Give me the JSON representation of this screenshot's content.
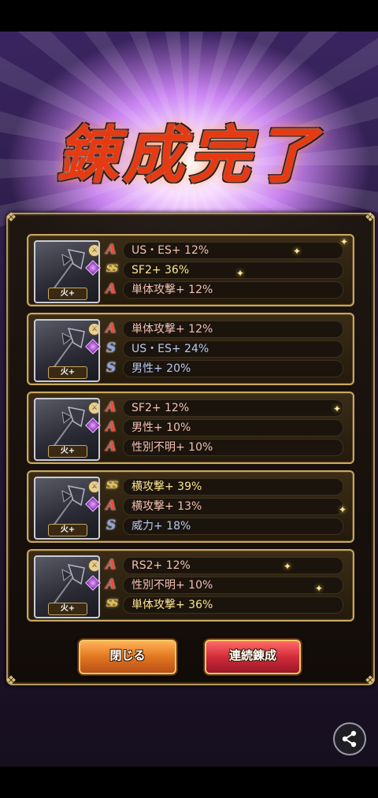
{
  "title": "錬成完了",
  "cards": [
    {
      "weapon_label": "火+",
      "rows": [
        {
          "rank": "A",
          "text": "US・ES+ 12%",
          "color": "#f2c0b4"
        },
        {
          "rank": "SS",
          "text": "SF2+ 36%",
          "color": "#ffe590"
        },
        {
          "rank": "A",
          "text": "単体攻撃+ 12%",
          "color": "#f2c0b4"
        }
      ]
    },
    {
      "weapon_label": "火+",
      "rows": [
        {
          "rank": "A",
          "text": "単体攻撃+ 12%",
          "color": "#f2c0b4"
        },
        {
          "rank": "S",
          "text": "US・ES+ 24%",
          "color": "#b8c8f4"
        },
        {
          "rank": "S",
          "text": "男性+ 20%",
          "color": "#b8c8f4"
        }
      ]
    },
    {
      "weapon_label": "火+",
      "rows": [
        {
          "rank": "A",
          "text": "SF2+ 12%",
          "color": "#f2c0b4"
        },
        {
          "rank": "A",
          "text": "男性+ 10%",
          "color": "#f2c0b4"
        },
        {
          "rank": "A",
          "text": "性別不明+ 10%",
          "color": "#f2c0b4"
        }
      ]
    },
    {
      "weapon_label": "火+",
      "rows": [
        {
          "rank": "SS",
          "text": "横攻撃+ 39%",
          "color": "#ffe590"
        },
        {
          "rank": "A",
          "text": "横攻撃+ 13%",
          "color": "#f2c0b4"
        },
        {
          "rank": "S",
          "text": "威力+ 18%",
          "color": "#b8c8f4"
        }
      ]
    },
    {
      "weapon_label": "火+",
      "rows": [
        {
          "rank": "A",
          "text": "RS2+ 12%",
          "color": "#f2c0b4"
        },
        {
          "rank": "A",
          "text": "性別不明+ 10%",
          "color": "#f2c0b4"
        },
        {
          "rank": "SS",
          "text": "単体攻撃+ 36%",
          "color": "#ffe590"
        }
      ]
    }
  ],
  "buttons": {
    "close_label": "閉じる",
    "continue_label": "連続錬成"
  },
  "icons": {
    "share": "share-icon",
    "weapon": "axe-icon",
    "gem": "gem-icon"
  }
}
